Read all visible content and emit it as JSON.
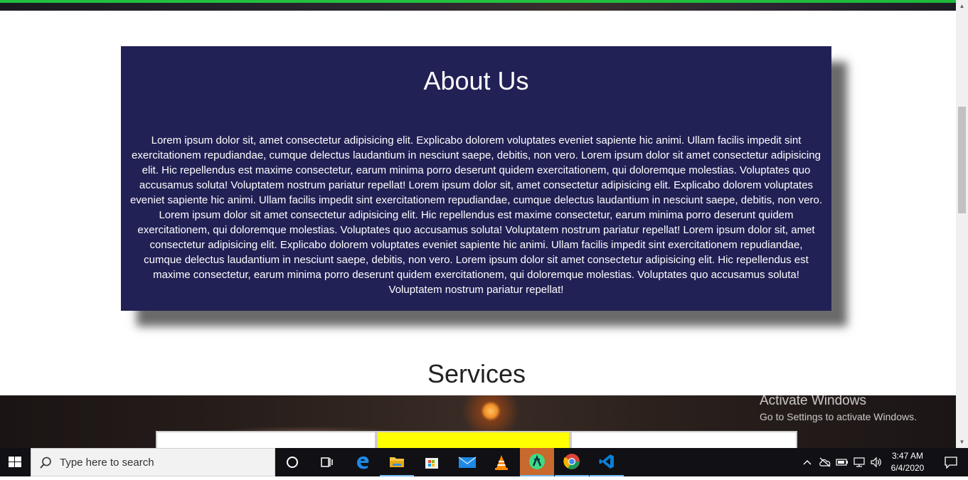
{
  "about": {
    "title": "About Us",
    "text": "Lorem ipsum dolor sit, amet consectetur adipisicing elit. Explicabo dolorem voluptates eveniet sapiente hic animi. Ullam facilis impedit sint exercitationem repudiandae, cumque delectus laudantium in nesciunt saepe, debitis, non vero. Lorem ipsum dolor sit amet consectetur adipisicing elit. Hic repellendus est maxime consectetur, earum minima porro deserunt quidem exercitationem, qui doloremque molestias. Voluptates quo accusamus soluta! Voluptatem nostrum pariatur repellat! Lorem ipsum dolor sit, amet consectetur adipisicing elit. Explicabo dolorem voluptates eveniet sapiente hic animi. Ullam facilis impedit sint exercitationem repudiandae, cumque delectus laudantium in nesciunt saepe, debitis, non vero. Lorem ipsum dolor sit amet consectetur adipisicing elit. Hic repellendus est maxime consectetur, earum minima porro deserunt quidem exercitationem, qui doloremque molestias. Voluptates quo accusamus soluta! Voluptatem nostrum pariatur repellat! Lorem ipsum dolor sit, amet consectetur adipisicing elit. Explicabo dolorem voluptates eveniet sapiente hic animi. Ullam facilis impedit sint exercitationem repudiandae, cumque delectus laudantium in nesciunt saepe, debitis, non vero. Lorem ipsum dolor sit amet consectetur adipisicing elit. Hic repellendus est maxime consectetur, earum minima porro deserunt quidem exercitationem, qui doloremque molestias. Voluptates quo accusamus soluta! Voluptatem nostrum pariatur repellat!",
    "background_color": "#222155"
  },
  "services": {
    "title": "Services",
    "highlight_color": "#ffff00"
  },
  "watermark": {
    "title": "Activate Windows",
    "subtitle": "Go to Settings to activate Windows."
  },
  "taskbar": {
    "search_placeholder": "Type here to search",
    "apps": [
      {
        "icon": "cortana-icon"
      },
      {
        "icon": "task-view-icon"
      },
      {
        "icon": "edge-icon"
      },
      {
        "icon": "file-explorer-icon"
      },
      {
        "icon": "store-icon"
      },
      {
        "icon": "mail-icon"
      },
      {
        "icon": "vlc-icon"
      },
      {
        "icon": "android-studio-icon"
      },
      {
        "icon": "chrome-icon"
      },
      {
        "icon": "vscode-icon"
      }
    ],
    "clock": {
      "time": "3:47 AM",
      "date": "6/4/2020"
    }
  }
}
